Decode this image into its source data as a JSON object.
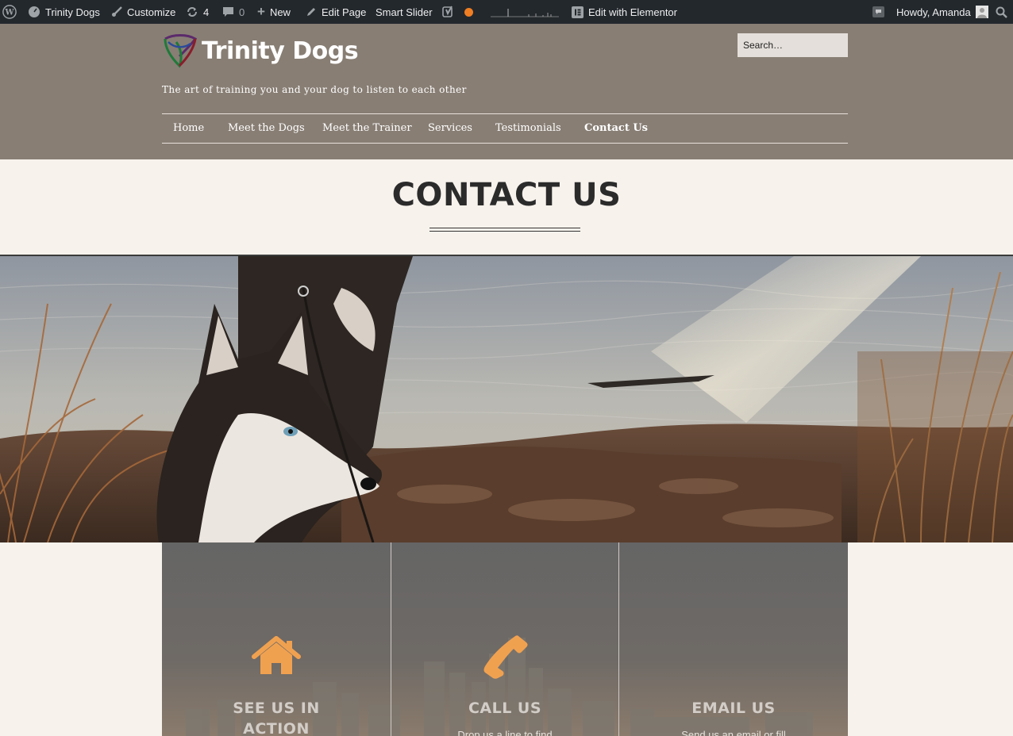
{
  "admin_bar": {
    "site_name": "Trinity Dogs",
    "customize": "Customize",
    "updates_count": "4",
    "comments_count": "0",
    "new": "New",
    "edit_page": "Edit Page",
    "smart_slider": "Smart Slider",
    "edit_elementor": "Edit with Elementor",
    "howdy": "Howdy, Amanda"
  },
  "header": {
    "site_title": "Trinity Dogs",
    "tagline": "The art of training you and your dog to listen to each other",
    "search_placeholder": "Search…"
  },
  "nav": {
    "items": [
      "Home",
      "Meet the Dogs",
      "Meet the Trainer",
      "Services",
      "Testimonials",
      "Contact Us"
    ],
    "active": "Contact Us"
  },
  "page": {
    "title": "CONTACT US"
  },
  "panels": [
    {
      "title_line1": "SEE US IN",
      "title_line2": "ACTION",
      "icon": "home-icon"
    },
    {
      "title": "CALL US",
      "text": "Drop us a line to find",
      "icon": "phone-icon"
    },
    {
      "title": "EMAIL US",
      "text": "Send us an email or fill"
    }
  ],
  "colors": {
    "admin_bar": "#23282d",
    "header": "#887e74",
    "page_bg": "#f7f2ec",
    "accent_icon": "#f0a150"
  }
}
